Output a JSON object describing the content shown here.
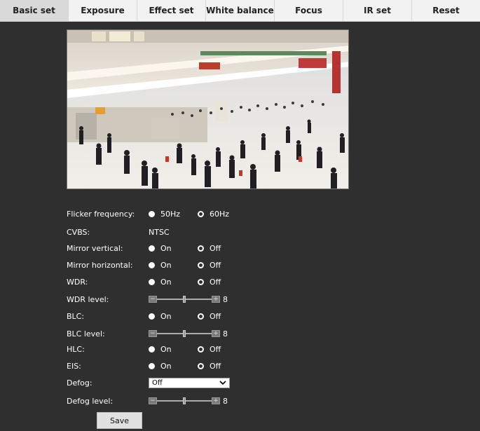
{
  "tabs": [
    {
      "label": "Basic set",
      "active": true
    },
    {
      "label": "Exposure"
    },
    {
      "label": "Effect set"
    },
    {
      "label": "White balance"
    },
    {
      "label": "Focus"
    },
    {
      "label": "IR set"
    },
    {
      "label": "Reset"
    }
  ],
  "settings": {
    "flicker": {
      "label": "Flicker frequency:",
      "opt1": "50Hz",
      "opt2": "60Hz",
      "selected": "50Hz"
    },
    "cvbs": {
      "label": "CVBS:",
      "value": "NTSC"
    },
    "mirror_vertical": {
      "label": "Mirror vertical:",
      "opt1": "On",
      "opt2": "Off",
      "selected": "On"
    },
    "mirror_horizontal": {
      "label": "Mirror horizontal:",
      "opt1": "On",
      "opt2": "Off",
      "selected": "On"
    },
    "wdr": {
      "label": "WDR:",
      "opt1": "On",
      "opt2": "Off",
      "selected": "On"
    },
    "wdr_level": {
      "label": "WDR level:",
      "value": "8",
      "fraction": 0.5
    },
    "blc": {
      "label": "BLC:",
      "opt1": "On",
      "opt2": "Off",
      "selected": "On"
    },
    "blc_level": {
      "label": "BLC level:",
      "value": "8",
      "fraction": 0.5
    },
    "hlc": {
      "label": "HLC:",
      "opt1": "On",
      "opt2": "Off",
      "selected": "On"
    },
    "eis": {
      "label": "EIS:",
      "opt1": "On",
      "opt2": "Off",
      "selected": "On"
    },
    "defog": {
      "label": "Defog:",
      "value": "Off"
    },
    "defog_level": {
      "label": "Defog level:",
      "value": "8",
      "fraction": 0.5
    }
  },
  "save_label": "Save"
}
